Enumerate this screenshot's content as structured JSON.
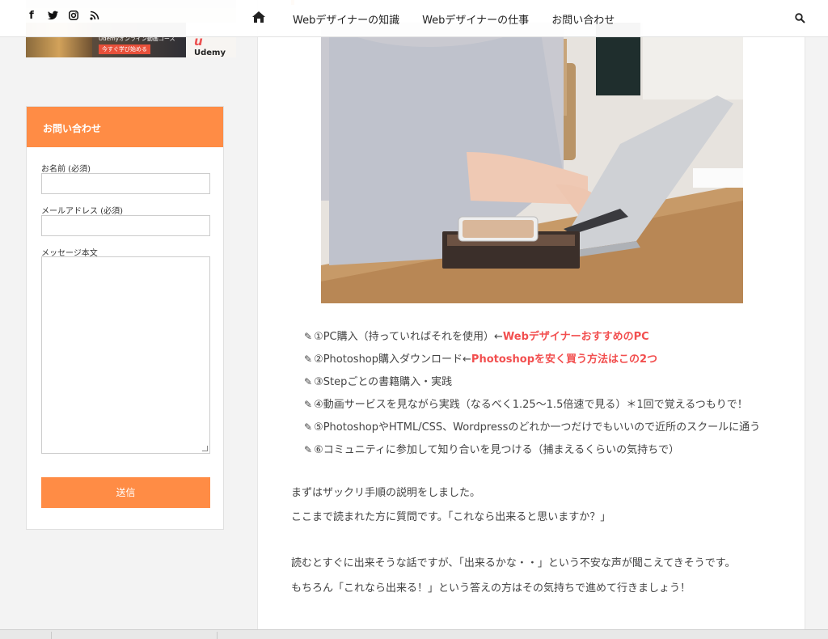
{
  "nav": {
    "social_icons": [
      "facebook-icon",
      "twitter-icon",
      "instagram-icon",
      "rss-icon"
    ],
    "items": [
      "Webデザイナーの知識",
      "Webデザイナーの仕事",
      "お問い合わせ"
    ]
  },
  "banner": {
    "text": "Udemyオンライン動画コース",
    "button": "今すぐ学び始める",
    "logo": "Udemy"
  },
  "contact": {
    "title": "お問い合わせ",
    "name_label": "お名前 (必須)",
    "email_label": "メールアドレス (必須)",
    "message_label": "メッセージ本文",
    "submit": "送信"
  },
  "steps": [
    {
      "text": "①PC購入（持っていればそれを使用）←",
      "link": "WebデザイナーおすすめのPC"
    },
    {
      "text": "②Photoshop購入ダウンロード←",
      "link": "Photoshopを安く買う方法はこの2つ"
    },
    {
      "text": "③Stepごとの書籍購入・実践",
      "link": ""
    },
    {
      "text": "④動画サービスを見ながら実践（なるべく1.25～1.5倍速で見る）＊1回で覚えるつもりで！",
      "link": ""
    },
    {
      "text": "⑤PhotoshopやHTML/CSS、Wordpressのどれか一つだけでもいいので近所のスクールに通う",
      "link": ""
    },
    {
      "text": "⑥コミュニティに参加して知り合いを見つける（捕まえるくらいの気持ちで）",
      "link": ""
    }
  ],
  "paragraphs": {
    "p1": "まずはザックリ手順の説明をしました。",
    "p2": "ここまで読まれた方に質問です。「これなら出来ると思いますか？」",
    "p3": "読むとすぐに出来そうな話ですが、「出来るかな・・」という不安な声が聞こえてきそうです。",
    "p4": "もちろん「これなら出来る！」という答えの方はその気持ちで進めて行きましょう！"
  },
  "colors": {
    "accent": "#ff8c45",
    "link": "#f24f4f"
  }
}
